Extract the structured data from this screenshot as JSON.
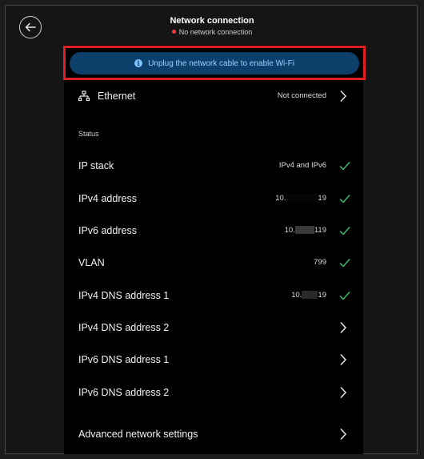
{
  "header": {
    "title": "Network connection",
    "status": "No network connection"
  },
  "banner": {
    "text": "Unplug the network cable to enable Wi-Fi"
  },
  "ethernet": {
    "label": "Ethernet",
    "value": "Not connected"
  },
  "status_heading": "Status",
  "rows": [
    {
      "label": "IP stack",
      "value": "IPv4 and IPv6",
      "check": true
    },
    {
      "label": "IPv4 address",
      "value_prefix": "10.",
      "value_suffix": "19",
      "check": true
    },
    {
      "label": "IPv6 address",
      "value_prefix": "10.",
      "value_suffix": "119",
      "check": true
    },
    {
      "label": "VLAN",
      "value": "799",
      "check": true
    },
    {
      "label": "IPv4 DNS address 1",
      "value_prefix": "10.",
      "value_suffix": "19",
      "check": true
    },
    {
      "label": "IPv4 DNS address 2"
    },
    {
      "label": "IPv6 DNS address 1"
    },
    {
      "label": "IPv6 DNS address 2"
    },
    {
      "label": "Advanced network settings"
    }
  ],
  "colors": {
    "check": "#35c26f",
    "banner_bg": "#0d3f6b",
    "highlight": "#e02020",
    "status_dot": "#ff3b3b"
  },
  "icons": {
    "back": "arrow-left-icon",
    "info": "info-icon",
    "ethernet": "ethernet-icon",
    "chevron": "chevron-right-icon",
    "check": "check-icon"
  }
}
